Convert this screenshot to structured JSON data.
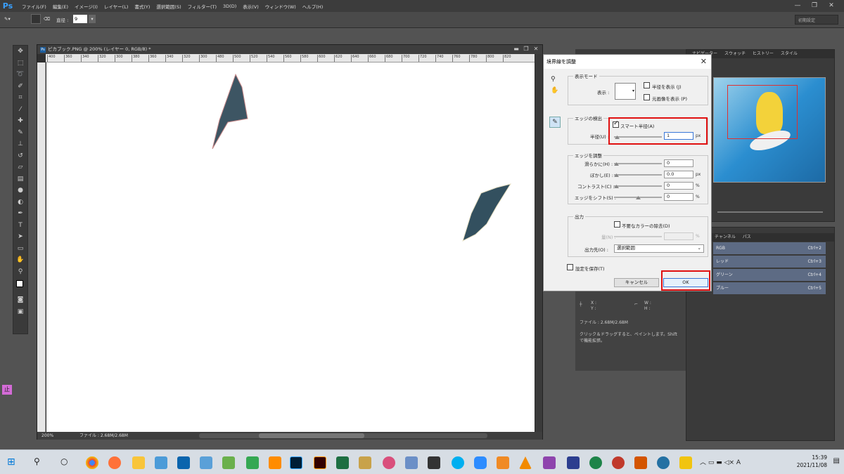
{
  "menubar": {
    "app_icon": "Ps",
    "items": [
      "ファイル(F)",
      "編集(E)",
      "イメージ(I)",
      "レイヤー(L)",
      "書式(Y)",
      "選択範囲(S)",
      "フィルター(T)",
      "3D(D)",
      "表示(V)",
      "ウィンドウ(W)",
      "ヘルプ(H)"
    ],
    "minimize": "—",
    "restore": "❐",
    "close": "✕"
  },
  "optbar": {
    "diameter_label": "直径 :",
    "diameter_value": "9",
    "workspace": "初期設定"
  },
  "document": {
    "tab_title": "ピカブック.PNG @ 200% (レイヤー 0, RGB/8) *",
    "ruler_h": [
      "400",
      "360",
      "340",
      "320",
      "300",
      "380",
      "360",
      "340",
      "320",
      "300",
      "480",
      "500",
      "520",
      "540",
      "560",
      "580",
      "600",
      "620",
      "640",
      "660",
      "680",
      "700",
      "720",
      "740",
      "760",
      "780",
      "800",
      "820"
    ],
    "zoom": "200%",
    "file_info": "ファイル : 2.68M/2.68M"
  },
  "dialog": {
    "title": "境界線を調整",
    "view_mode": {
      "label": "表示モード",
      "show_label": "表示 :",
      "show_radius": "半径を表示 (J)",
      "show_original": "元画像を表示 (P)"
    },
    "edge_detection": {
      "label": "エッジの検出",
      "smart_radius": "スマート半径(A)",
      "smart_radius_checked": true,
      "radius_label": "半径(U) :",
      "radius_value": "1",
      "radius_unit": "px"
    },
    "adjust_edge": {
      "label": "エッジを調整",
      "smooth_label": "滑らかに(H) :",
      "smooth_value": "0",
      "feather_label": "ぼかし(E) :",
      "feather_value": "0.0",
      "feather_unit": "px",
      "contrast_label": "コントラスト(C) :",
      "contrast_value": "0",
      "contrast_unit": "%",
      "shift_label": "エッジをシフト(S) :",
      "shift_value": "0",
      "shift_unit": "%"
    },
    "output": {
      "label": "出力",
      "decontaminate": "不要なカラーの除去(D)",
      "amount_label": "量(N) :",
      "amount_unit": "%",
      "output_to_label": "出力先(O) :",
      "output_to_value": "選択範囲"
    },
    "remember": "設定を保存(T)",
    "cancel": "キャンセル",
    "ok": "OK"
  },
  "nav_panel": {
    "tabs": [
      "ナビゲーター",
      "スウォッチ",
      "ヒストリー",
      "スタイル"
    ]
  },
  "channels_panel": {
    "tabs": [
      "チャンネル",
      "パス"
    ],
    "rows": [
      {
        "name": "RGB",
        "shortcut": "Ctrl+2"
      },
      {
        "name": "レッド",
        "shortcut": "Ctrl+3"
      },
      {
        "name": "グリーン",
        "shortcut": "Ctrl+4"
      },
      {
        "name": "ブルー",
        "shortcut": "Ctrl+5"
      }
    ]
  },
  "info_panel": {
    "x": "X :",
    "y": "Y :",
    "w": "W :",
    "h": "H :",
    "file": "ファイル : 2.68M/2.68M",
    "hint": "クリック＆ドラッグすると、ペイントします。Shift で機能拡張。"
  },
  "left_badge": "止",
  "taskbar": {
    "time": "15:39",
    "date": "2021/11/08",
    "lang": "A"
  },
  "colors": {
    "accent_red": "#e01010",
    "ps_blue": "#39a0ff"
  }
}
